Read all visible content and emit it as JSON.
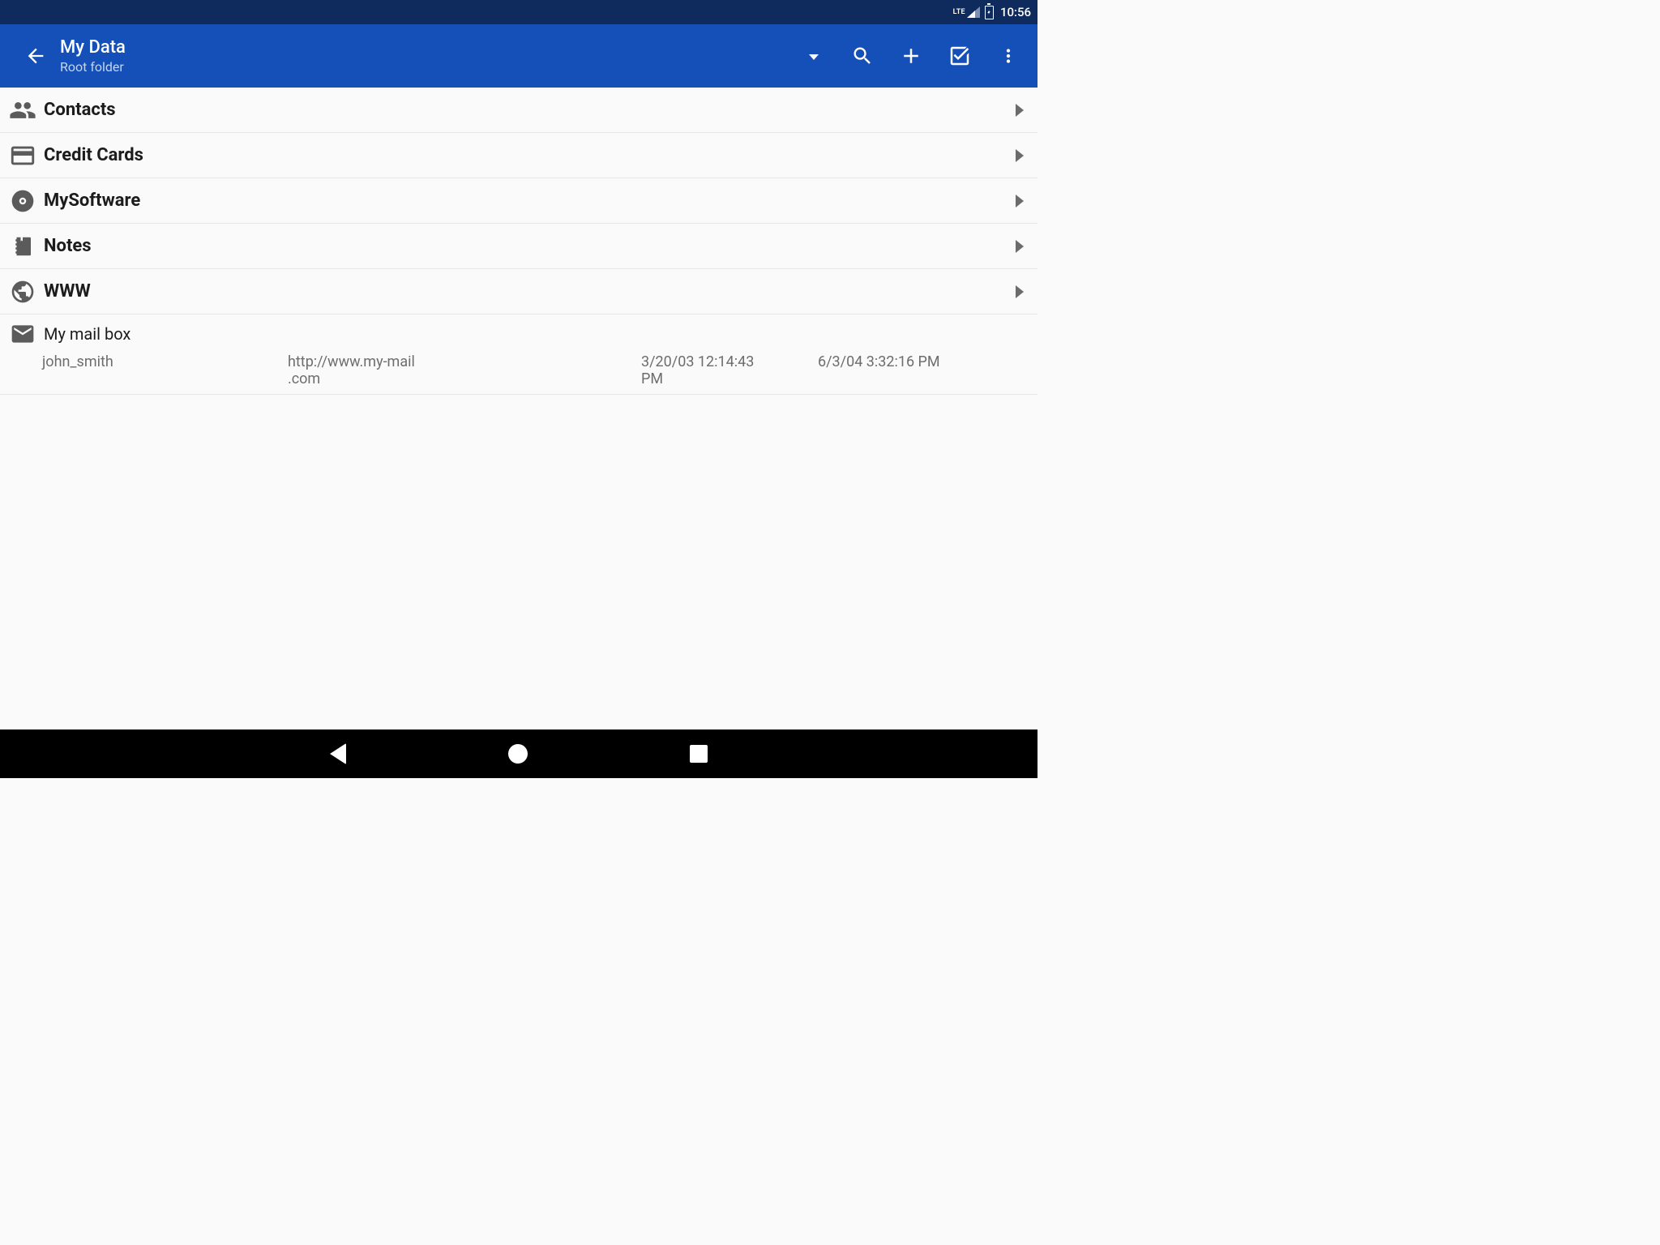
{
  "status": {
    "network": "LTE",
    "clock": "10:56"
  },
  "appbar": {
    "title": "My Data",
    "subtitle": "Root folder"
  },
  "folders": [
    {
      "icon": "contacts-icon",
      "label": "Contacts"
    },
    {
      "icon": "creditcard-icon",
      "label": "Credit Cards"
    },
    {
      "icon": "disc-icon",
      "label": "MySoftware"
    },
    {
      "icon": "notes-icon",
      "label": "Notes"
    },
    {
      "icon": "globe-icon",
      "label": "WWW"
    }
  ],
  "entry": {
    "title": "My mail box",
    "user": "john_smith",
    "url_line1": "http://www.my-mail",
    "url_line2": ".com",
    "date1_line1": "3/20/03 12:14:43",
    "date1_line2": "PM",
    "date2": "6/3/04 3:32:16 PM"
  }
}
